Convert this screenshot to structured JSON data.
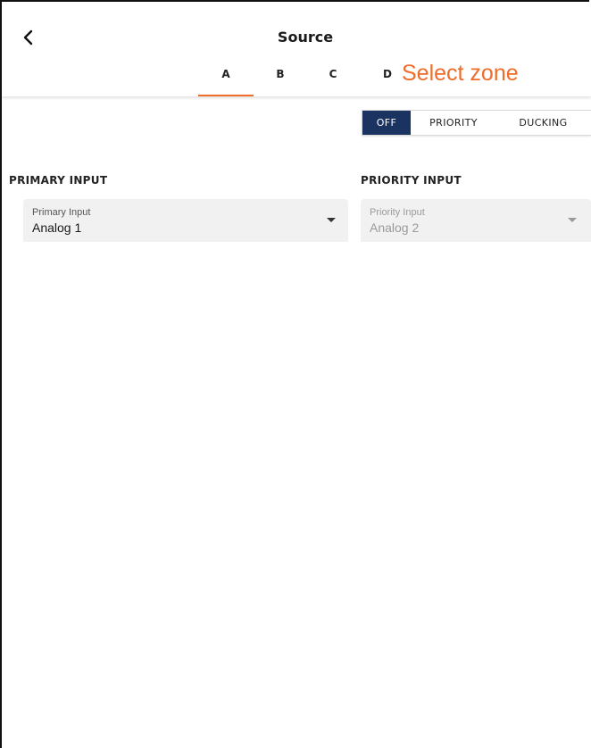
{
  "header": {
    "title": "Source",
    "back_icon": "chevron-left-icon"
  },
  "zone_tabs": [
    {
      "label": "A",
      "active": true
    },
    {
      "label": "B",
      "active": false
    },
    {
      "label": "C",
      "active": false
    },
    {
      "label": "D",
      "active": false
    }
  ],
  "annotation": {
    "text": "Select zone",
    "color": "#ef6c2a"
  },
  "priority_mode": {
    "options": [
      "OFF",
      "PRIORITY",
      "DUCKING"
    ],
    "selected": "OFF",
    "selected_color": "#1b3360"
  },
  "primary": {
    "section_label": "PRIMARY INPUT",
    "field_label": "Primary Input",
    "value": "Analog 1",
    "enabled": true
  },
  "priority": {
    "section_label": "PRIORITY INPUT",
    "field_label": "Priority Input",
    "value": "Analog 2",
    "enabled": false
  },
  "colors": {
    "accent": "#ef6c2a",
    "navy": "#1b3360"
  }
}
